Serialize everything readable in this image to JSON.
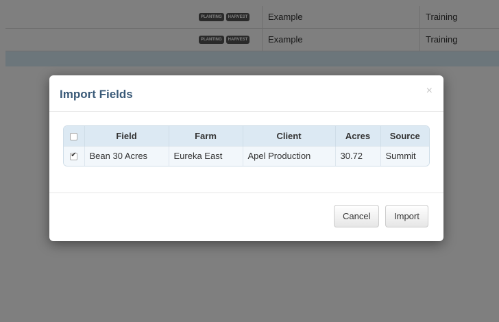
{
  "background": {
    "rows": [
      {
        "tags": [
          "PLANTING",
          "HARVEST"
        ],
        "name": "Example",
        "type": "Training"
      },
      {
        "tags": [
          "PLANTING",
          "HARVEST"
        ],
        "name": "Example",
        "type": "Training"
      }
    ]
  },
  "modal": {
    "title": "Import Fields",
    "close": "×",
    "table": {
      "headers": [
        "Field",
        "Farm",
        "Client",
        "Acres",
        "Source"
      ],
      "rows": [
        {
          "checked": true,
          "field": "Bean 30 Acres",
          "farm": "Eureka East",
          "client": "Apel Production",
          "acres": "30.72",
          "source": "Summit"
        }
      ]
    },
    "buttons": {
      "cancel": "Cancel",
      "import": "Import"
    }
  }
}
